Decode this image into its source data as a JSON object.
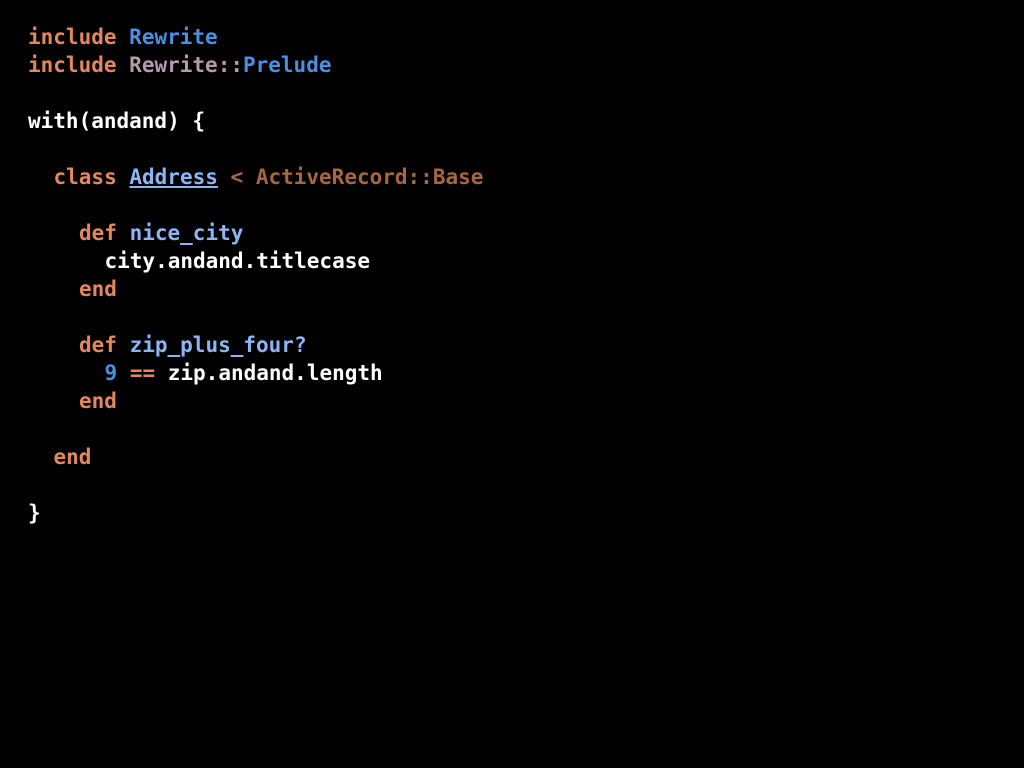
{
  "colors": {
    "background": "#000000",
    "keyword": "#e3885d",
    "constant_blue": "#4a8fe0",
    "constant_muted": "#b699b0",
    "method_name": "#8bb5f4",
    "superclass": "#a86640",
    "default_text": "#ffffff",
    "number": "#4a8fe0",
    "operator": "#e3885d"
  },
  "code_lines": [
    {
      "indent": 0,
      "tokens": [
        {
          "text": "include",
          "color": "#e3885d"
        },
        {
          "text": " ",
          "color": "#ffffff"
        },
        {
          "text": "Rewrite",
          "color": "#4a8fe0"
        }
      ]
    },
    {
      "indent": 0,
      "tokens": [
        {
          "text": "include",
          "color": "#e3885d"
        },
        {
          "text": " ",
          "color": "#ffffff"
        },
        {
          "text": "Rewrite",
          "color": "#b699b0"
        },
        {
          "text": "::",
          "color": "#b699b0"
        },
        {
          "text": "Prelude",
          "color": "#4a8fe0"
        }
      ]
    },
    {
      "indent": 0,
      "tokens": []
    },
    {
      "indent": 0,
      "tokens": [
        {
          "text": "with(andand) {",
          "color": "#ffffff"
        }
      ]
    },
    {
      "indent": 0,
      "tokens": []
    },
    {
      "indent": 1,
      "tokens": [
        {
          "text": "class",
          "color": "#e3885d"
        },
        {
          "text": " ",
          "color": "#ffffff"
        },
        {
          "text": "Address",
          "color": "#8bb5f4",
          "underline": true
        },
        {
          "text": " < ActiveRecord::Base",
          "color": "#a86640"
        }
      ]
    },
    {
      "indent": 0,
      "tokens": []
    },
    {
      "indent": 2,
      "tokens": [
        {
          "text": "def",
          "color": "#e3885d"
        },
        {
          "text": " ",
          "color": "#ffffff"
        },
        {
          "text": "nice_city",
          "color": "#8bb5f4"
        }
      ]
    },
    {
      "indent": 3,
      "tokens": [
        {
          "text": "city.andand.titlecase",
          "color": "#ffffff"
        }
      ]
    },
    {
      "indent": 2,
      "tokens": [
        {
          "text": "end",
          "color": "#e3885d"
        }
      ]
    },
    {
      "indent": 0,
      "tokens": []
    },
    {
      "indent": 2,
      "tokens": [
        {
          "text": "def",
          "color": "#e3885d"
        },
        {
          "text": " ",
          "color": "#ffffff"
        },
        {
          "text": "zip_plus_four?",
          "color": "#8bb5f4"
        }
      ]
    },
    {
      "indent": 3,
      "tokens": [
        {
          "text": "9",
          "color": "#4a8fe0"
        },
        {
          "text": " ",
          "color": "#ffffff"
        },
        {
          "text": "==",
          "color": "#e3885d"
        },
        {
          "text": " zip.andand.length",
          "color": "#ffffff"
        }
      ]
    },
    {
      "indent": 2,
      "tokens": [
        {
          "text": "end",
          "color": "#e3885d"
        }
      ]
    },
    {
      "indent": 0,
      "tokens": []
    },
    {
      "indent": 1,
      "tokens": [
        {
          "text": "end",
          "color": "#e3885d"
        }
      ]
    },
    {
      "indent": 0,
      "tokens": []
    },
    {
      "indent": 0,
      "tokens": [
        {
          "text": "}",
          "color": "#ffffff"
        }
      ]
    }
  ]
}
